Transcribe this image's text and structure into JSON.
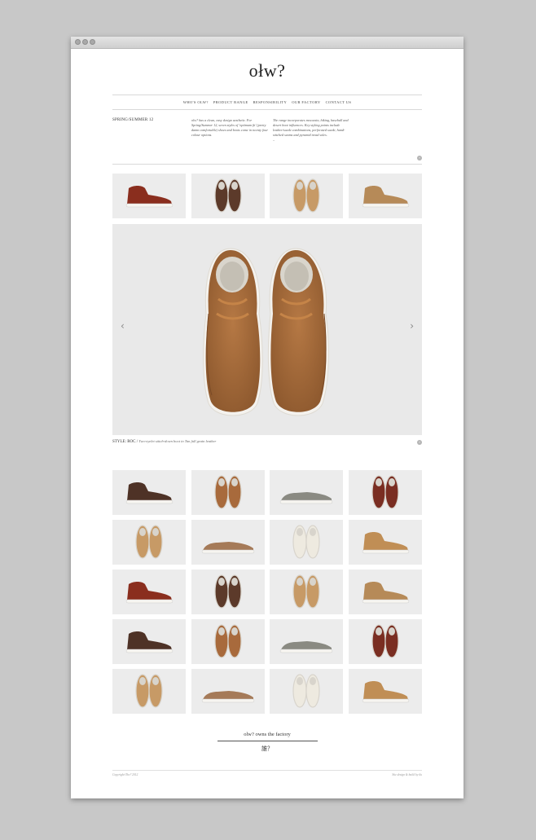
{
  "brand": {
    "logo": "ołw?"
  },
  "nav": {
    "items": [
      "WHO'S OLW?",
      "PRODUCT RANGE",
      "RESPONSIBILITY",
      "OUR FACTORY",
      "CONTACT US"
    ]
  },
  "intro": {
    "season": "SPRING/SUMMER 12",
    "col1": "olw? has a clean, easy design aesthetic. For Spring/Summer 12, seven styles of 'optimum fit' (pretty damn comfortable) shoes and boots come in twenty four colour options.",
    "col2": "The range incorporates moccasin, hiking, baseball and desert boot influences. Key styling points include leather/suede combinations, perforated suede, hand-stitched seams and pyramid tread soles.",
    "col2_more": "–"
  },
  "hero": {
    "style_label": "STYLE: ROC",
    "separator": "/",
    "style_desc": "Two-eyelet stitch-down boot in Tan full grain leather"
  },
  "footer": {
    "factory_link": "olw? owns the factory",
    "kanji": "誰？",
    "copyright": "Copyright Ołw? 2012",
    "credit": "Site design & build by ilu"
  },
  "colors": {
    "background": "#c8c8c8",
    "tan": "#a86a3c",
    "brown": "#6b3e25",
    "oxblood": "#8a2e1e",
    "grey": "#8a8a82",
    "cream": "#eeeae0",
    "sand": "#c79a66"
  },
  "icons": {
    "prev": "chevron-left-icon",
    "next": "chevron-right-icon",
    "info": "plus-circle-icon"
  }
}
